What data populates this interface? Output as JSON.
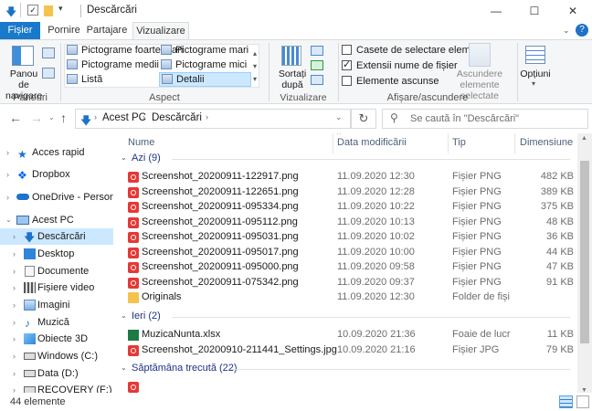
{
  "window": {
    "title": "Descărcări",
    "minimize": "—",
    "maximize": "☐",
    "close": "✕"
  },
  "ribbon_tabs": [
    "Fișier",
    "Pornire",
    "Partajare",
    "Vizualizare"
  ],
  "ribbon": {
    "panouri": {
      "nav_pane_label": "Panou de navigare",
      "group": "Panouri"
    },
    "aspect": {
      "group": "Aspect",
      "items": [
        "Pictograme foarte mari",
        "Pictograme mari",
        "Pictograme medii",
        "Pictograme mici",
        "Listă",
        "Detalii"
      ]
    },
    "vizualizare_curenta": {
      "sort_label": "Sortați după",
      "group": "Vizualizare curentă"
    },
    "afisare": {
      "group": "Afișare/ascundere",
      "checkboxes": [
        {
          "label": "Casete de selectare element",
          "checked": false
        },
        {
          "label": "Extensii nume de fișier",
          "checked": true
        },
        {
          "label": "Elemente ascunse",
          "checked": false
        }
      ],
      "hide_selected": "Ascundere elemente selectate",
      "options": "Opțiuni"
    }
  },
  "address": {
    "path": [
      "Acest PC",
      "Descărcări"
    ],
    "search_placeholder": "Se caută în \"Descărcări\""
  },
  "nav_pane": [
    {
      "label": "Acces rapid",
      "icon": "star-icon"
    },
    {
      "label": "Dropbox",
      "icon": "dropbox-icon"
    },
    {
      "label": "OneDrive - Person",
      "icon": "cloud-icon"
    },
    {
      "label": "Acest PC",
      "icon": "computer-icon"
    },
    {
      "label": "Descărcări",
      "icon": "download-icon",
      "selected": true
    },
    {
      "label": "Desktop",
      "icon": "desktop-icon"
    },
    {
      "label": "Documente",
      "icon": "document-icon"
    },
    {
      "label": "Fișiere video",
      "icon": "video-icon"
    },
    {
      "label": "Imagini",
      "icon": "image-icon"
    },
    {
      "label": "Muzică",
      "icon": "music-icon"
    },
    {
      "label": "Obiecte 3D",
      "icon": "cube-icon"
    },
    {
      "label": "Windows (C:)",
      "icon": "drive-icon"
    },
    {
      "label": "Data (D:)",
      "icon": "drive-icon"
    },
    {
      "label": "RECOVERY (F:)",
      "icon": "drive-icon"
    }
  ],
  "columns": [
    "Nume",
    "Data modificării",
    "Tip",
    "Dimensiune"
  ],
  "groups": [
    {
      "label": "Azi (9)",
      "files": [
        {
          "name": "Screenshot_20200911-122917.png",
          "date": "11.09.2020 12:30",
          "type": "Fișier PNG",
          "size": "482 KB",
          "kind": "png"
        },
        {
          "name": "Screenshot_20200911-122651.png",
          "date": "11.09.2020 12:28",
          "type": "Fișier PNG",
          "size": "389 KB",
          "kind": "png"
        },
        {
          "name": "Screenshot_20200911-095334.png",
          "date": "11.09.2020 10:22",
          "type": "Fișier PNG",
          "size": "375 KB",
          "kind": "png"
        },
        {
          "name": "Screenshot_20200911-095112.png",
          "date": "11.09.2020 10:13",
          "type": "Fișier PNG",
          "size": "48 KB",
          "kind": "png"
        },
        {
          "name": "Screenshot_20200911-095031.png",
          "date": "11.09.2020 10:02",
          "type": "Fișier PNG",
          "size": "36 KB",
          "kind": "png"
        },
        {
          "name": "Screenshot_20200911-095017.png",
          "date": "11.09.2020 10:00",
          "type": "Fișier PNG",
          "size": "44 KB",
          "kind": "png"
        },
        {
          "name": "Screenshot_20200911-095000.png",
          "date": "11.09.2020 09:58",
          "type": "Fișier PNG",
          "size": "47 KB",
          "kind": "png"
        },
        {
          "name": "Screenshot_20200911-075342.png",
          "date": "11.09.2020 09:37",
          "type": "Fișier PNG",
          "size": "91 KB",
          "kind": "png"
        },
        {
          "name": "Originals",
          "date": "11.09.2020 12:30",
          "type": "Folder de fiși",
          "size": "",
          "kind": "folder"
        }
      ]
    },
    {
      "label": "Ieri (2)",
      "files": [
        {
          "name": "MuzicaNunta.xlsx",
          "date": "10.09.2020 21:36",
          "type": "Foaie de lucr",
          "size": "11 KB",
          "kind": "xlsx"
        },
        {
          "name": "Screenshot_20200910-211441_Settings.jpg",
          "date": "10.09.2020 21:16",
          "type": "Fișier JPG",
          "size": "79 KB",
          "kind": "png"
        }
      ]
    },
    {
      "label": "Săptămâna trecută (22)",
      "files": []
    }
  ],
  "status": {
    "count": "44 elemente"
  }
}
